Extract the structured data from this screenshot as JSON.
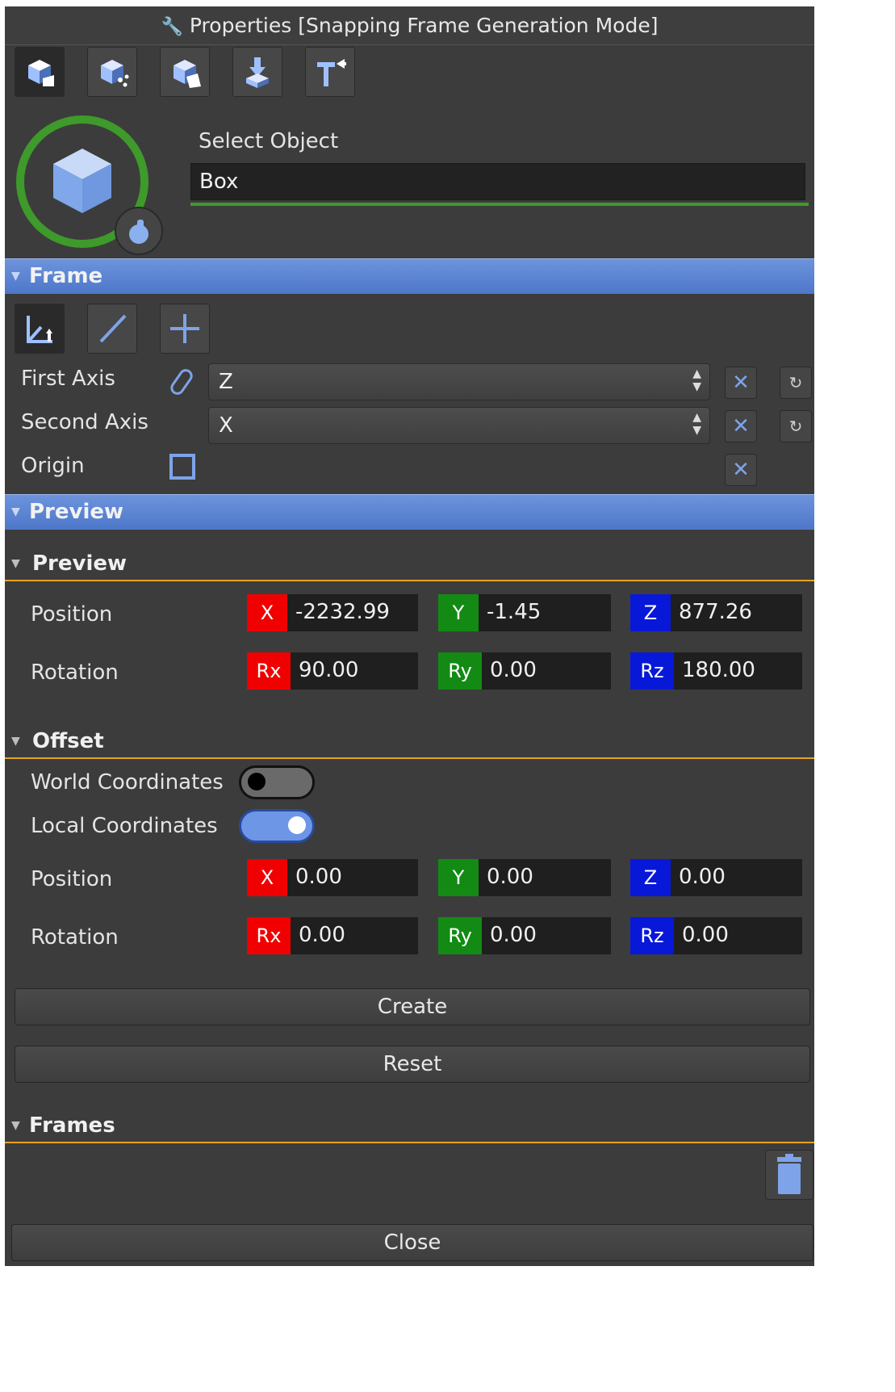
{
  "title": "Properties [Snapping Frame Generation Mode]",
  "toolbar": {
    "buttons": [
      "mode-object-icon",
      "mode-points-icon",
      "mode-surface-icon",
      "mode-drop-icon",
      "mode-axis-icon"
    ]
  },
  "select_object": {
    "label": "Select Object",
    "value": "Box"
  },
  "frame": {
    "header": "Frame",
    "first_axis_label": "First Axis",
    "first_axis_value": "Z",
    "second_axis_label": "Second Axis",
    "second_axis_value": "X",
    "origin_label": "Origin"
  },
  "preview_section": {
    "header": "Preview",
    "sub_header": "Preview",
    "position_label": "Position",
    "rotation_label": "Rotation",
    "position": {
      "x_tag": "X",
      "x": "-2232.99",
      "y_tag": "Y",
      "y": "-1.45",
      "z_tag": "Z",
      "z": "877.26"
    },
    "rotation": {
      "x_tag": "Rx",
      "x": "90.00",
      "y_tag": "Ry",
      "y": "0.00",
      "z_tag": "Rz",
      "z": "180.00"
    }
  },
  "offset": {
    "header": "Offset",
    "world_label": "World Coordinates",
    "world_on": false,
    "local_label": "Local Coordinates",
    "local_on": true,
    "position_label": "Position",
    "rotation_label": "Rotation",
    "position": {
      "x_tag": "X",
      "x": "0.00",
      "y_tag": "Y",
      "y": "0.00",
      "z_tag": "Z",
      "z": "0.00"
    },
    "rotation": {
      "x_tag": "Rx",
      "x": "0.00",
      "y_tag": "Ry",
      "y": "0.00",
      "z_tag": "Rz",
      "z": "0.00"
    }
  },
  "buttons": {
    "create": "Create",
    "reset": "Reset",
    "close": "Close"
  },
  "frames": {
    "header": "Frames"
  },
  "colors": {
    "accent_blue": "#6d93dc",
    "ring_green": "#3e9a2a",
    "divider_orange": "#e8a21a",
    "x_red": "#f00000",
    "y_green": "#138a13",
    "z_blue": "#0818d8"
  }
}
